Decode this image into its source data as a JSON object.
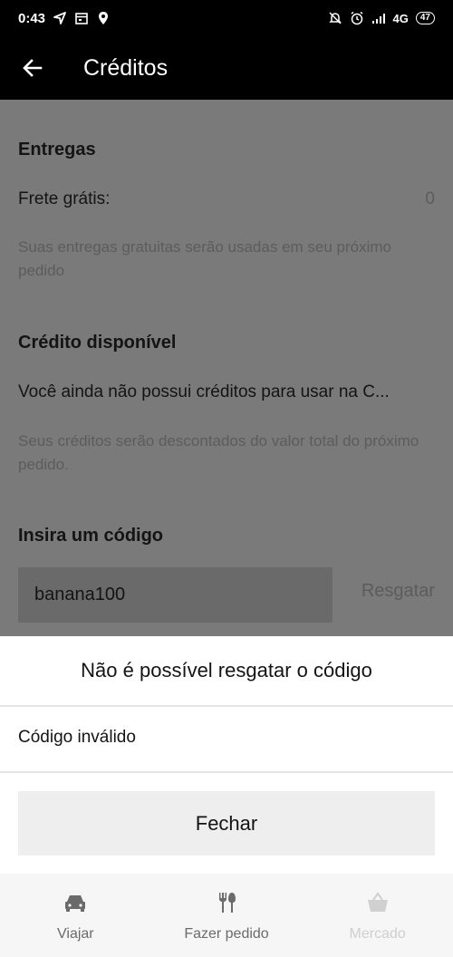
{
  "status_bar": {
    "time": "0:43",
    "network": "4G",
    "battery": "47"
  },
  "app_bar": {
    "title": "Créditos"
  },
  "deliveries": {
    "heading": "Entregas",
    "free_shipping_label": "Frete grátis:",
    "free_shipping_value": "0",
    "helper": "Suas entregas gratuitas serão usadas em seu próximo pedido"
  },
  "credit": {
    "heading": "Crédito disponível",
    "message": "Você ainda não possui créditos para usar na C...",
    "helper": "Seus créditos serão descontados do valor total do próximo pedido."
  },
  "promo": {
    "heading": "Insira um código",
    "input_value": "banana100",
    "redeem_label": "Resgatar"
  },
  "dialog": {
    "title": "Não é possível resgatar o código",
    "message": "Código inválido",
    "close_label": "Fechar"
  },
  "bottom_nav": {
    "items": [
      {
        "label": "Viajar",
        "icon": "car-icon"
      },
      {
        "label": "Fazer pedido",
        "icon": "fork-knife-icon"
      },
      {
        "label": "Mercado",
        "icon": "basket-icon"
      }
    ]
  }
}
